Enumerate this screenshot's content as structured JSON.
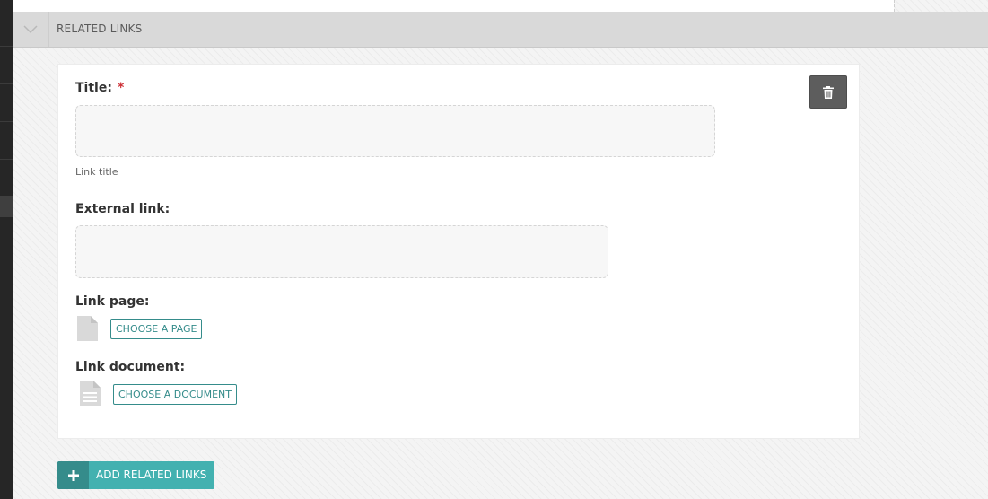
{
  "section": {
    "title": "RELATED LINKS",
    "toggle_icon": "chevron-down-icon"
  },
  "form": {
    "title": {
      "label": "Title:",
      "required_marker": "*",
      "value": "",
      "placeholder": "",
      "help_text": "Link title"
    },
    "external_link": {
      "label": "External link:",
      "value": "",
      "placeholder": ""
    },
    "link_page": {
      "label": "Link page:",
      "icon": "page-icon",
      "button_label": "CHOOSE A PAGE"
    },
    "link_document": {
      "label": "Link document:",
      "icon": "document-icon",
      "button_label": "CHOOSE A DOCUMENT"
    },
    "delete_icon": "trash-icon"
  },
  "add_button": {
    "label": "ADD RELATED LINKS",
    "icon": "plus-icon"
  },
  "colors": {
    "accent": "#43b1b0",
    "accent_dark": "#358c8b",
    "required": "#cd3238",
    "header_bg": "#d9d9d9",
    "delete_bg": "#5d5d5d"
  }
}
